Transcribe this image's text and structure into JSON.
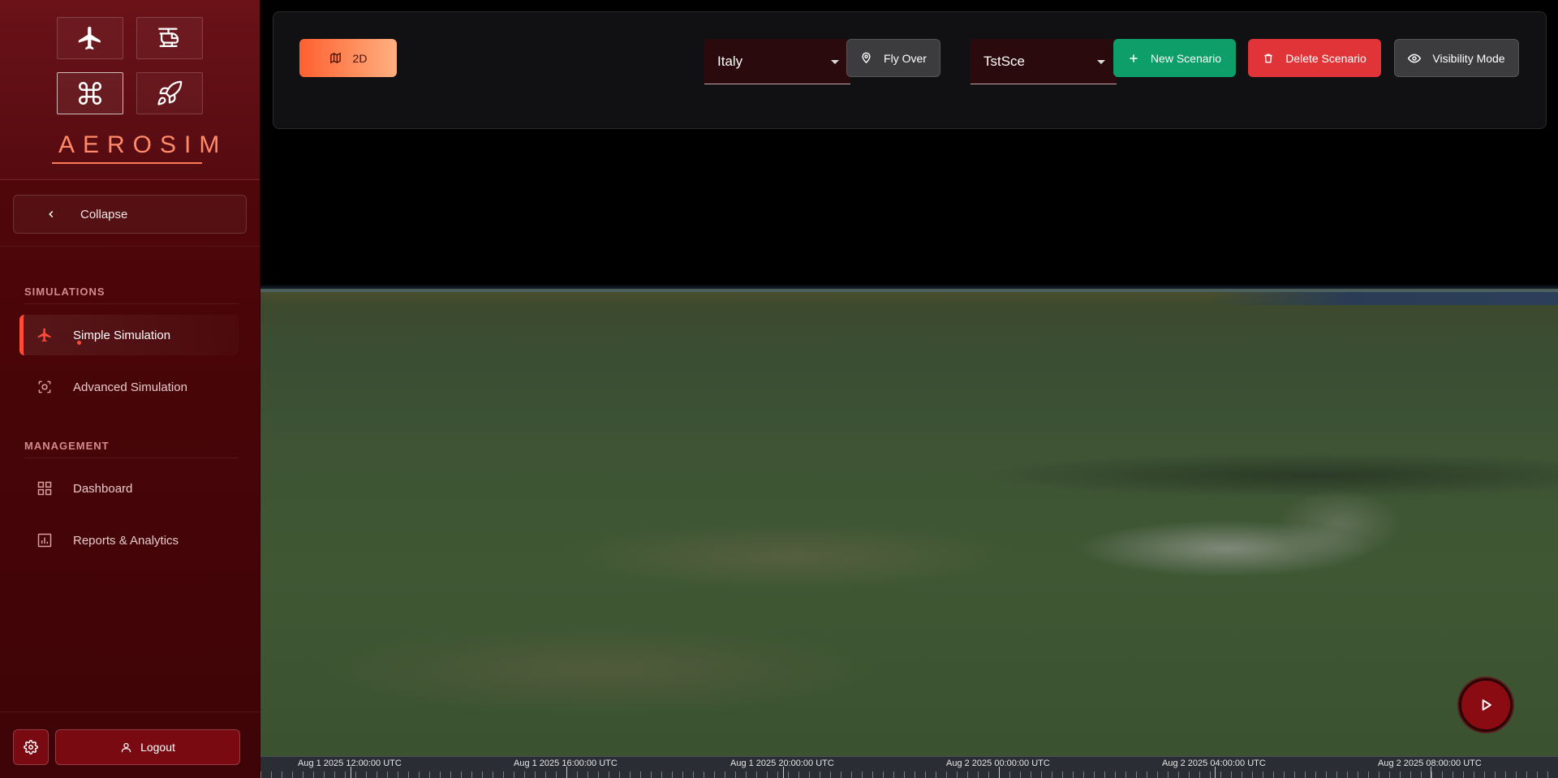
{
  "app": {
    "logo": "AEROSIM"
  },
  "sidebar": {
    "vehicles": [
      {
        "name": "airplane-icon",
        "active": false
      },
      {
        "name": "helicopter-icon",
        "active": false
      },
      {
        "name": "drone-icon",
        "active": true
      },
      {
        "name": "rocket-icon",
        "active": false
      }
    ],
    "collapse_label": "Collapse",
    "sections": [
      {
        "title": "SIMULATIONS",
        "items": [
          {
            "label": "Simple Simulation",
            "icon": "airplane-icon",
            "active": true
          },
          {
            "label": "Advanced Simulation",
            "icon": "scan-icon",
            "active": false
          }
        ]
      },
      {
        "title": "MANAGEMENT",
        "items": [
          {
            "label": "Dashboard",
            "icon": "dashboard-icon",
            "active": false
          },
          {
            "label": "Reports & Analytics",
            "icon": "chart-icon",
            "active": false
          }
        ]
      }
    ],
    "logout_label": "Logout"
  },
  "toolbar": {
    "view_mode_label": "2D",
    "region": {
      "value": "Italy"
    },
    "fly_over_label": "Fly Over",
    "scenario": {
      "value": "TstSce"
    },
    "new_scenario_label": "New Scenario",
    "delete_scenario_label": "Delete Scenario",
    "visibility_mode_label": "Visibility Mode"
  },
  "timeline": {
    "labels": [
      "Aug 1 2025 12:00:00 UTC",
      "Aug 1 2025 16:00:00 UTC",
      "Aug 1 2025 20:00:00 UTC",
      "Aug 2 2025 00:00:00 UTC",
      "Aug 2 2025 04:00:00 UTC",
      "Aug 2 2025 08:00:00 UTC"
    ]
  },
  "colors": {
    "accent": "#ff4b3a",
    "sidebar_bg": "#4a0508",
    "new_scenario": "#0e9e6a",
    "delete_scenario": "#e03438"
  }
}
